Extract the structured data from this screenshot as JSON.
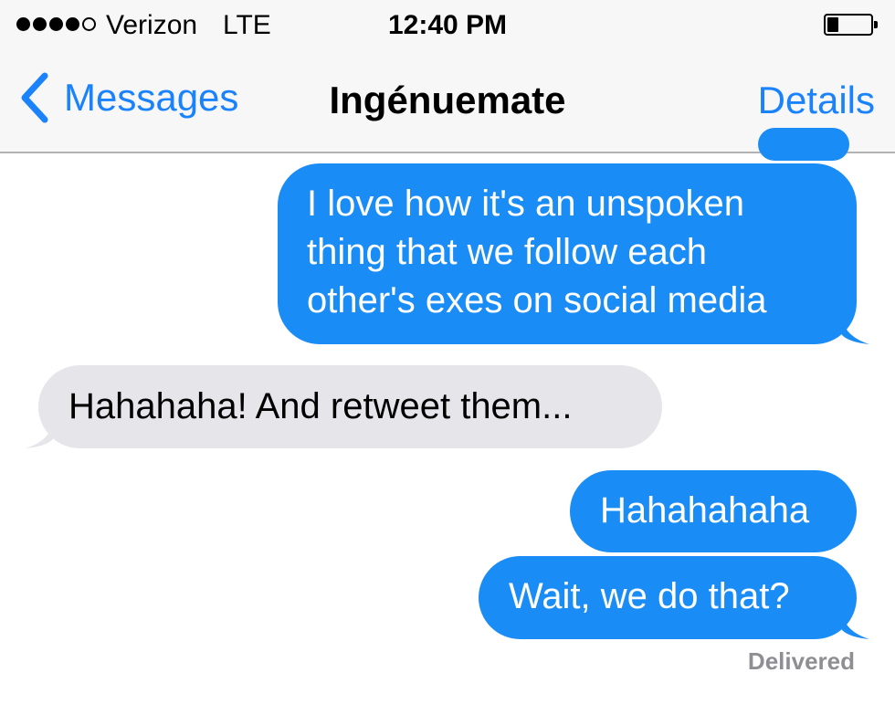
{
  "status_bar": {
    "signal_dots_filled": 4,
    "signal_dots_total": 5,
    "carrier": "Verizon",
    "network": "LTE",
    "time": "12:40 PM",
    "battery_level": 0.25
  },
  "nav": {
    "back_label": "Messages",
    "title": "Ingénuemate",
    "details_label": "Details"
  },
  "messages": [
    {
      "direction": "sent",
      "text": "I love how it's an unspoken\nthing that we follow each\nother's exes on social media"
    },
    {
      "direction": "received",
      "text": "Hahahaha! And retweet them..."
    },
    {
      "direction": "sent",
      "text": "Hahahahaha"
    },
    {
      "direction": "sent",
      "text": "Wait, we do that?"
    }
  ],
  "delivery_status": "Delivered",
  "colors": {
    "accent": "#1a82fb",
    "sent_bubble": "#1a8cf6",
    "received_bubble": "#e5e5ea",
    "bar_background": "#f7f7f8"
  },
  "icons": [
    "signal-dots-icon",
    "battery-icon",
    "chevron-left-icon"
  ]
}
